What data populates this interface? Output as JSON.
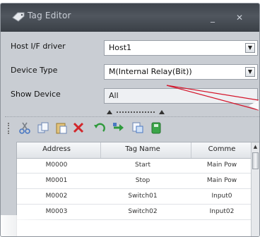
{
  "window": {
    "title": "Tag Editor",
    "minimize_glyph": "_",
    "close_glyph": "✕"
  },
  "form": {
    "host_label": "Host I/F driver",
    "host_value": "Host1",
    "device_type_label": "Device Type",
    "device_type_value": "M(Internal Relay(Bit))",
    "show_device_label": "Show Device",
    "show_device_value": "All"
  },
  "toolbar": {
    "icons": [
      "cut-icon",
      "copy-icon",
      "paste-icon",
      "delete-icon",
      "undo-icon",
      "redo-icon",
      "add-icon",
      "save-icon"
    ]
  },
  "grid": {
    "columns": [
      "Address",
      "Tag Name",
      "Comme"
    ],
    "rows": [
      [
        "M0000",
        "Start",
        "Main Pow"
      ],
      [
        "M0001",
        "Stop",
        "Main Pow"
      ],
      [
        "M0002",
        "Switch01",
        "Input0"
      ],
      [
        "M0003",
        "Switch02",
        "Input02"
      ]
    ]
  },
  "colors": {
    "titlebar": "#454b53",
    "panel": "#c9cdd3",
    "callout_line": "#d4142a"
  }
}
